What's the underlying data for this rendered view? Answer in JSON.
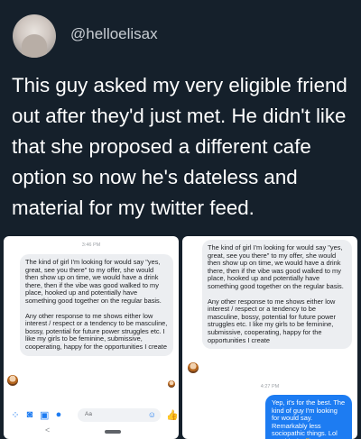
{
  "user": {
    "handle": "@helloelisax"
  },
  "tweet": {
    "text": "This guy asked my very eligible friend out after they'd just met. He didn't like that she proposed a different cafe option so now he's dateless and material for my twitter feed."
  },
  "left_screenshot": {
    "timestamp": "3:46 PM",
    "message_p1": "The kind of girl I'm looking for would say \"yes, great, see you there\" to my offer, she would then show up on time, we would have a drink there, then if the vibe was good walked to my place, hooked up and potentially have something good together on the regular basis.",
    "message_p2": "Any other response to me shows either low interest / respect or a tendency to be masculine, bossy, potential for future power struggles etc. I like my girls to be feminine, submissive, cooperating, happy for the opportunities I create",
    "composer_placeholder": "Aa",
    "icons": [
      "apps-icon",
      "camera-icon",
      "image-icon",
      "mic-icon",
      "smile-icon",
      "like-icon"
    ],
    "nav_back": "<"
  },
  "right_screenshot": {
    "message_p1": "The kind of girl I'm looking for would say \"yes, great, see you there\" to my offer, she would then show up on time, we would have a drink there, then if the vibe was good walked to my place, hooked up and potentially have something good together on the regular basis.",
    "message_p2": "Any other response to me shows either low interest / respect or a tendency to be masculine, bossy, potential for future power struggles etc. I like my girls to be feminine, submissive, cooperating, happy for the opportunities I create",
    "timestamp": "4:27 PM",
    "reply": "Yep, it's for the best. The kind of guy I'm looking for would say. Remarkably less sociopathic things. Lol good luck! 👋"
  },
  "colors": {
    "background": "#15202b",
    "messenger_blue": "#1d7cf2",
    "incoming_bubble": "#eceef1"
  }
}
